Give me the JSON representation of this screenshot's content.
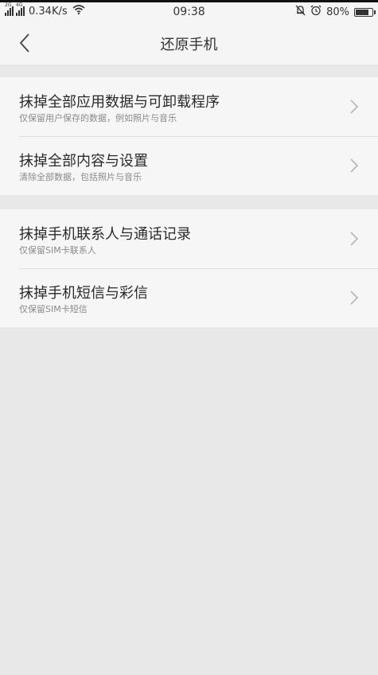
{
  "status_bar": {
    "signal_1_tag": "2G",
    "signal_2_tag": "4G",
    "net_speed": "0.34K/s",
    "time": "09:38",
    "battery_percent": "80%",
    "battery_level": 0.8,
    "icons": [
      "signal-icon",
      "signal-icon",
      "wifi-icon",
      "bell-muted-icon",
      "alarm-icon",
      "battery-icon"
    ]
  },
  "header": {
    "title": "还原手机",
    "back_icon": "chevron-left-icon"
  },
  "groups": [
    {
      "items": [
        {
          "title": "抹掉全部应用数据与可卸载程序",
          "subtitle": "仅保留用户保存的数据，例如照片与音乐"
        },
        {
          "title": "抹掉全部内容与设置",
          "subtitle": "清除全部数据，包括照片与音乐"
        }
      ]
    },
    {
      "items": [
        {
          "title": "抹掉手机联系人与通话记录",
          "subtitle": "仅保留SIM卡联系人"
        },
        {
          "title": "抹掉手机短信与彩信",
          "subtitle": "仅保留SIM卡短信"
        }
      ]
    }
  ],
  "colors": {
    "background": "#e8e8e8",
    "card": "#f6f6f6",
    "text": "#2a2a2a",
    "subtext": "#8a8a8a",
    "chevron": "#b5b5b5"
  }
}
